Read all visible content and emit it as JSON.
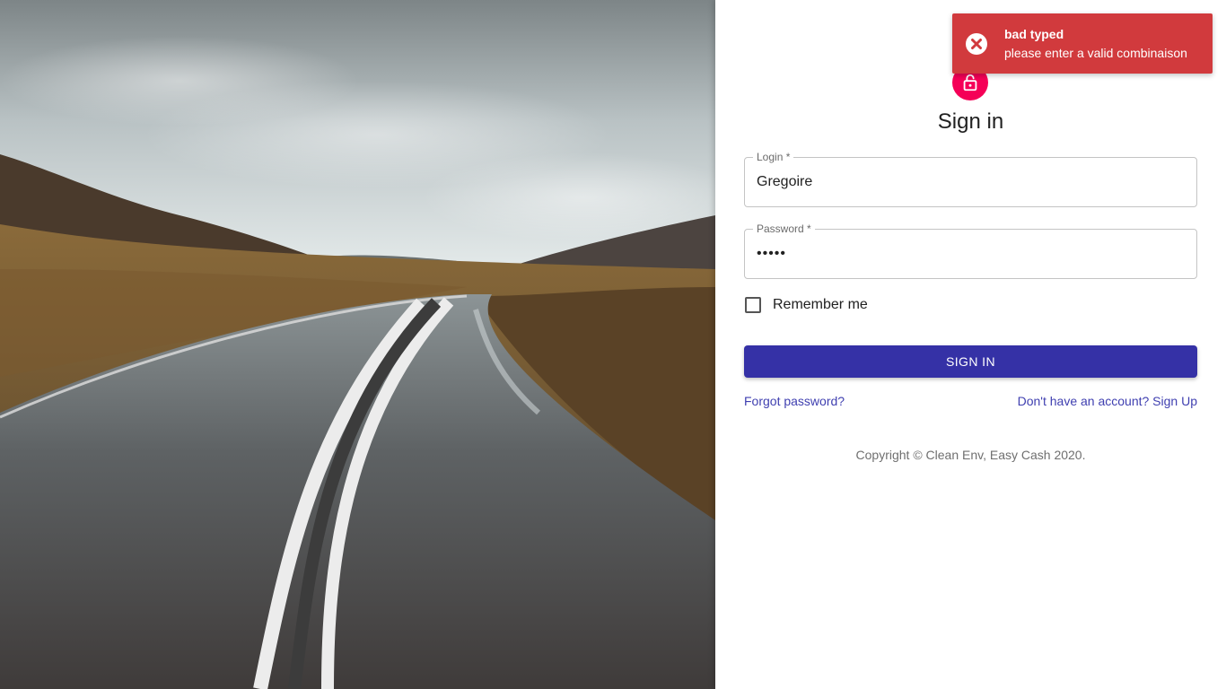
{
  "toast": {
    "title": "bad typed",
    "message": "please enter a valid combinaison",
    "icon": "error-x-icon",
    "color": "#d13a3d"
  },
  "form": {
    "title": "Sign in",
    "avatar_icon": "lock-icon",
    "avatar_color": "#f50057",
    "login": {
      "label": "Login *",
      "value": "Gregoire"
    },
    "password": {
      "label": "Password *",
      "value": "•••••"
    },
    "remember_label": "Remember me",
    "remember_checked": false,
    "submit_label": "SIGN IN",
    "submit_color": "#3531a6",
    "forgot_link": "Forgot password?",
    "signup_link": "Don't have an account? Sign Up",
    "copyright": "Copyright © Clean Env, Easy Cash 2020."
  }
}
